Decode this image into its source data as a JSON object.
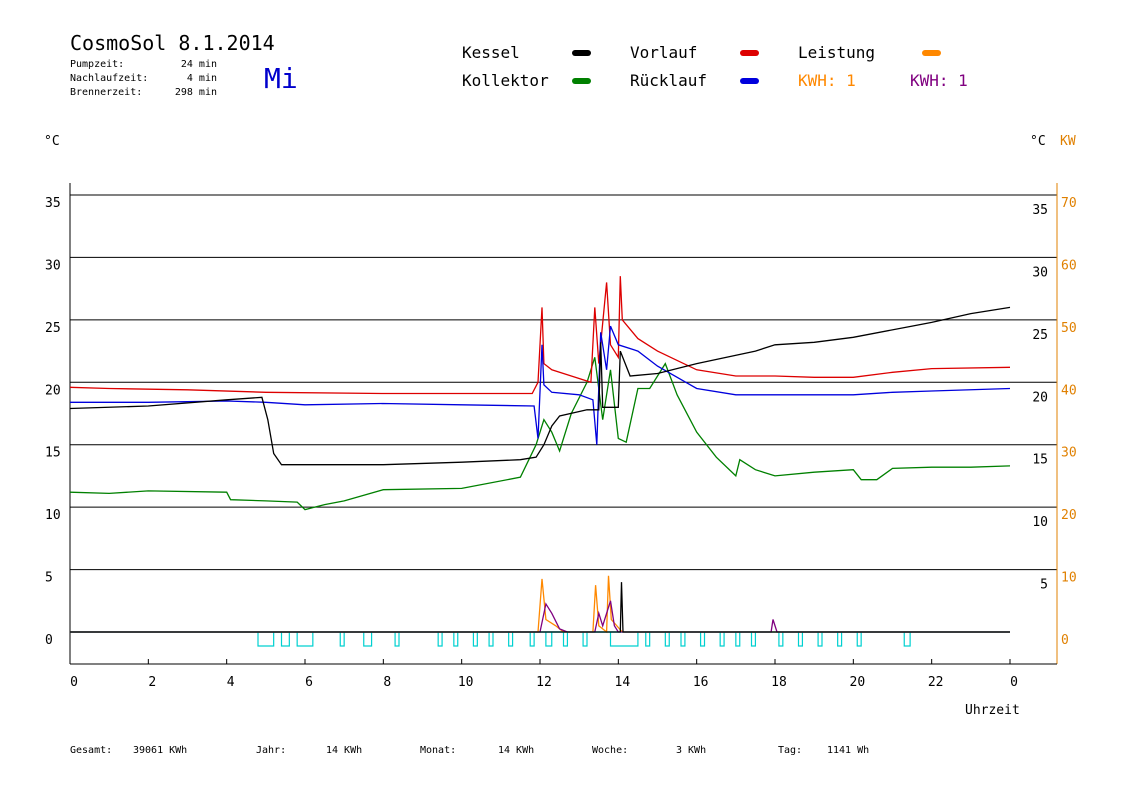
{
  "header": {
    "title": "CosmoSol 8.1.2014",
    "day": "Mi",
    "stats": [
      {
        "label": "Pumpzeit:",
        "value": "24 min"
      },
      {
        "label": "Nachlaufzeit:",
        "value": "4 min"
      },
      {
        "label": "Brennerzeit:",
        "value": "298 min"
      }
    ]
  },
  "legend": [
    {
      "label": "Kessel",
      "color": "#000000"
    },
    {
      "label": "Vorlauf",
      "color": "#dd0000"
    },
    {
      "label": "Leistung",
      "color": "#ff8800"
    },
    {
      "label": "Kollektor",
      "color": "#008000"
    },
    {
      "label": "Rücklauf",
      "color": "#0000dd"
    }
  ],
  "kwh_labels": [
    {
      "text": "KWH: 1",
      "color": "#ff8800"
    },
    {
      "text": "KWH: 1",
      "color": "#800080"
    }
  ],
  "axes": {
    "left_unit": "°C",
    "right_unit_c": "°C",
    "right_unit_kw": "KW",
    "xlabel": "Uhrzeit",
    "left_ticks": [
      "35",
      "30",
      "25",
      "20",
      "15",
      "10",
      "5",
      "0"
    ],
    "right_ticks_c": [
      "35",
      "30",
      "25",
      "20",
      "15",
      "10",
      "5"
    ],
    "right_ticks_kw": [
      "70",
      "60",
      "50",
      "40",
      "30",
      "20",
      "10",
      "0"
    ],
    "x_ticks": [
      "0",
      "2",
      "4",
      "6",
      "8",
      "10",
      "12",
      "14",
      "16",
      "18",
      "20",
      "22",
      "0"
    ]
  },
  "footer": [
    {
      "label": "Gesamt:",
      "value": "39061 KWh"
    },
    {
      "label": "Jahr:",
      "value": "14 KWh"
    },
    {
      "label": "Monat:",
      "value": "14 KWh"
    },
    {
      "label": "Woche:",
      "value": "3 KWh"
    },
    {
      "label": "Tag:",
      "value": "1141 Wh"
    }
  ],
  "colors": {
    "kessel": "#000000",
    "vorlauf": "#dd0000",
    "ruecklauf": "#0000dd",
    "kollektor": "#008000",
    "leistung": "#ff8800",
    "kwh2": "#800080",
    "pump": "#00d0d0",
    "axis_right": "#e08000"
  },
  "chart_data": {
    "type": "line",
    "xlim": [
      0,
      24
    ],
    "ylim_left": [
      -2.5,
      36
    ],
    "ylim_right_kw": [
      -5,
      72
    ],
    "grid": true,
    "series": [
      {
        "name": "Kessel",
        "axis": "C",
        "points": [
          [
            0,
            17.9
          ],
          [
            2,
            18.1
          ],
          [
            4,
            18.6
          ],
          [
            4.9,
            18.8
          ],
          [
            5.05,
            17
          ],
          [
            5.2,
            14.3
          ],
          [
            5.4,
            13.4
          ],
          [
            8,
            13.4
          ],
          [
            10,
            13.6
          ],
          [
            11.5,
            13.8
          ],
          [
            11.9,
            14
          ],
          [
            12.1,
            15
          ],
          [
            12.3,
            16.5
          ],
          [
            12.5,
            17.3
          ],
          [
            13.2,
            17.8
          ],
          [
            13.5,
            17.8
          ],
          [
            13.55,
            23.2
          ],
          [
            13.6,
            18
          ],
          [
            14,
            18
          ],
          [
            14.05,
            22.5
          ],
          [
            14.3,
            20.5
          ],
          [
            15,
            20.7
          ],
          [
            16,
            21.5
          ],
          [
            17.5,
            22.5
          ],
          [
            18,
            23
          ],
          [
            19,
            23.2
          ],
          [
            20,
            23.6
          ],
          [
            21.5,
            24.5
          ],
          [
            22,
            24.8
          ],
          [
            23,
            25.5
          ],
          [
            24,
            26
          ]
        ]
      },
      {
        "name": "Vorlauf",
        "axis": "C",
        "points": [
          [
            0,
            19.6
          ],
          [
            1,
            19.5
          ],
          [
            3,
            19.4
          ],
          [
            5,
            19.2
          ],
          [
            8,
            19.1
          ],
          [
            11.8,
            19.1
          ],
          [
            11.95,
            20
          ],
          [
            12.05,
            26
          ],
          [
            12.1,
            21.5
          ],
          [
            12.3,
            21
          ],
          [
            12.8,
            20.5
          ],
          [
            13.3,
            20
          ],
          [
            13.4,
            26
          ],
          [
            13.5,
            21.5
          ],
          [
            13.7,
            28
          ],
          [
            13.8,
            23
          ],
          [
            14,
            22
          ],
          [
            14.05,
            28.5
          ],
          [
            14.1,
            25
          ],
          [
            14.5,
            23.5
          ],
          [
            15,
            22.5
          ],
          [
            16,
            21
          ],
          [
            17,
            20.5
          ],
          [
            18,
            20.5
          ],
          [
            19,
            20.4
          ],
          [
            20,
            20.4
          ],
          [
            21,
            20.8
          ],
          [
            22,
            21.1
          ],
          [
            24,
            21.2
          ]
        ]
      },
      {
        "name": "Rücklauf",
        "axis": "C",
        "points": [
          [
            0,
            18.4
          ],
          [
            2,
            18.4
          ],
          [
            4,
            18.5
          ],
          [
            5,
            18.4
          ],
          [
            6,
            18.2
          ],
          [
            8,
            18.3
          ],
          [
            10,
            18.2
          ],
          [
            11.85,
            18.1
          ],
          [
            11.95,
            15.5
          ],
          [
            12.05,
            23
          ],
          [
            12.1,
            19.8
          ],
          [
            12.3,
            19.2
          ],
          [
            13,
            19
          ],
          [
            13.35,
            18.6
          ],
          [
            13.45,
            15
          ],
          [
            13.55,
            24
          ],
          [
            13.7,
            21
          ],
          [
            13.8,
            24.5
          ],
          [
            14,
            23
          ],
          [
            14.5,
            22.5
          ],
          [
            15,
            21.3
          ],
          [
            16,
            19.5
          ],
          [
            17,
            19
          ],
          [
            18,
            19
          ],
          [
            19,
            19
          ],
          [
            20,
            19
          ],
          [
            21,
            19.2
          ],
          [
            22,
            19.3
          ],
          [
            24,
            19.5
          ]
        ]
      },
      {
        "name": "Kollektor",
        "axis": "C",
        "points": [
          [
            0,
            11.2
          ],
          [
            1,
            11.1
          ],
          [
            2,
            11.3
          ],
          [
            4,
            11.2
          ],
          [
            4.1,
            10.6
          ],
          [
            5,
            10.5
          ],
          [
            5.8,
            10.4
          ],
          [
            6,
            9.8
          ],
          [
            6.5,
            10.2
          ],
          [
            7,
            10.5
          ],
          [
            8,
            11.4
          ],
          [
            10,
            11.5
          ],
          [
            11.5,
            12.4
          ],
          [
            11.9,
            15
          ],
          [
            12.1,
            17
          ],
          [
            12.3,
            16
          ],
          [
            12.5,
            14.5
          ],
          [
            12.8,
            17.5
          ],
          [
            13.2,
            20
          ],
          [
            13.4,
            22
          ],
          [
            13.6,
            17
          ],
          [
            13.8,
            21
          ],
          [
            14,
            15.5
          ],
          [
            14.2,
            15.2
          ],
          [
            14.5,
            19.5
          ],
          [
            14.8,
            19.5
          ],
          [
            15.2,
            21.5
          ],
          [
            15.5,
            19
          ],
          [
            16,
            16
          ],
          [
            16.5,
            14
          ],
          [
            17,
            12.5
          ],
          [
            17.1,
            13.8
          ],
          [
            17.5,
            13
          ],
          [
            18,
            12.5
          ],
          [
            19,
            12.8
          ],
          [
            20,
            13
          ],
          [
            20.2,
            12.2
          ],
          [
            20.6,
            12.2
          ],
          [
            21,
            13.1
          ],
          [
            22,
            13.2
          ],
          [
            23,
            13.2
          ],
          [
            24,
            13.3
          ]
        ]
      }
    ],
    "power_series": [
      {
        "name": "Leistung",
        "axis": "KW",
        "points": [
          [
            0,
            0
          ],
          [
            11.95,
            0
          ],
          [
            12.05,
            8.5
          ],
          [
            12.15,
            2
          ],
          [
            12.4,
            1
          ],
          [
            12.6,
            0
          ],
          [
            13.35,
            0
          ],
          [
            13.42,
            7.5
          ],
          [
            13.5,
            1
          ],
          [
            13.7,
            0
          ],
          [
            13.75,
            9
          ],
          [
            13.82,
            2
          ],
          [
            14.1,
            0
          ],
          [
            24,
            0
          ]
        ]
      },
      {
        "name": "KWH2",
        "axis": "KW",
        "points": [
          [
            0,
            0
          ],
          [
            12.0,
            0
          ],
          [
            12.15,
            4.5
          ],
          [
            12.3,
            3
          ],
          [
            12.5,
            0.5
          ],
          [
            12.7,
            0
          ],
          [
            13.4,
            0
          ],
          [
            13.5,
            3
          ],
          [
            13.6,
            1
          ],
          [
            13.8,
            5
          ],
          [
            13.9,
            1
          ],
          [
            14.0,
            0
          ],
          [
            17.9,
            0
          ],
          [
            17.95,
            2
          ],
          [
            18.05,
            0
          ],
          [
            24,
            0
          ]
        ]
      },
      {
        "name": "Kessel-KW",
        "axis": "KW",
        "points": [
          [
            0,
            0
          ],
          [
            14.05,
            0
          ],
          [
            14.08,
            8
          ],
          [
            14.12,
            0
          ],
          [
            24,
            0
          ]
        ]
      }
    ],
    "pump_pulses": [
      [
        4.8,
        5.2
      ],
      [
        5.4,
        5.6
      ],
      [
        5.8,
        6.2
      ],
      [
        6.9,
        7.0
      ],
      [
        7.5,
        7.7
      ],
      [
        8.3,
        8.4
      ],
      [
        9.4,
        9.5
      ],
      [
        9.8,
        9.9
      ],
      [
        10.3,
        10.4
      ],
      [
        10.7,
        10.8
      ],
      [
        11.2,
        11.3
      ],
      [
        11.75,
        11.85
      ],
      [
        12.15,
        12.3
      ],
      [
        12.6,
        12.7
      ],
      [
        13.1,
        13.2
      ],
      [
        13.8,
        14.5
      ],
      [
        14.7,
        14.8
      ],
      [
        15.2,
        15.3
      ],
      [
        15.6,
        15.7
      ],
      [
        16.1,
        16.2
      ],
      [
        16.6,
        16.7
      ],
      [
        17.0,
        17.1
      ],
      [
        17.4,
        17.5
      ],
      [
        18.1,
        18.2
      ],
      [
        18.6,
        18.7
      ],
      [
        19.1,
        19.2
      ],
      [
        19.6,
        19.7
      ],
      [
        20.1,
        20.2
      ],
      [
        21.3,
        21.45
      ]
    ]
  }
}
